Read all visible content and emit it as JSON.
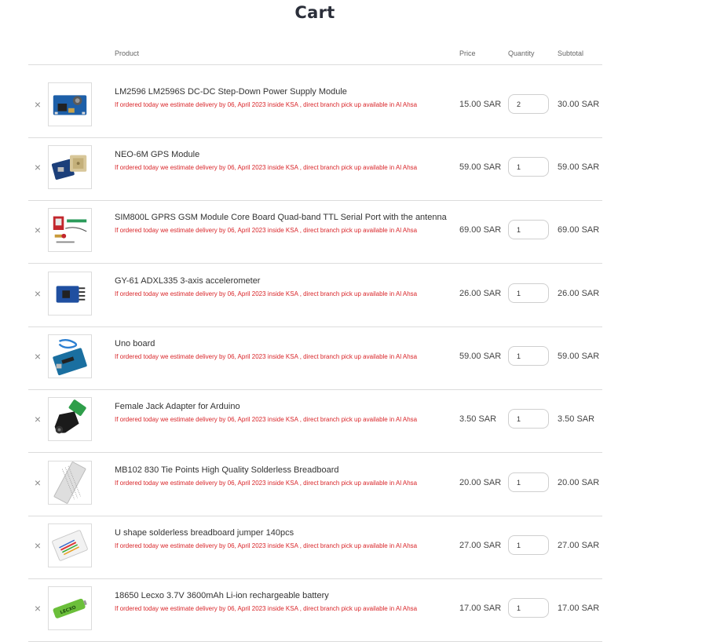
{
  "page": {
    "title": "Cart"
  },
  "table": {
    "headers": {
      "product": "Product",
      "price": "Price",
      "quantity": "Quantity",
      "subtotal": "Subtotal"
    }
  },
  "cart": {
    "remove_symbol": "×",
    "delivery_note": "If ordered today we estimate delivery by 06, April 2023 inside KSA , direct branch pick up available in Al Ahsa",
    "items": [
      {
        "name": "LM2596 LM2596S DC-DC Step-Down Power Supply Module",
        "price": "15.00 SAR",
        "quantity": "2",
        "subtotal": "30.00 SAR",
        "image": "blue-power-module"
      },
      {
        "name": "NEO-6M GPS Module",
        "price": "59.00 SAR",
        "quantity": "1",
        "subtotal": "59.00 SAR",
        "image": "gps-module"
      },
      {
        "name": "SIM800L GPRS GSM Module Core Board Quad-band TTL Serial Port with the antenna",
        "price": "69.00 SAR",
        "quantity": "1",
        "subtotal": "69.00 SAR",
        "image": "gsm-module"
      },
      {
        "name": "GY-61 ADXL335 3-axis accelerometer",
        "price": "26.00 SAR",
        "quantity": "1",
        "subtotal": "26.00 SAR",
        "image": "accelerometer-board"
      },
      {
        "name": "Uno board",
        "price": "59.00 SAR",
        "quantity": "1",
        "subtotal": "59.00 SAR",
        "image": "arduino-uno"
      },
      {
        "name": "Female Jack Adapter for Arduino",
        "price": "3.50 SAR",
        "quantity": "1",
        "subtotal": "3.50 SAR",
        "image": "dc-jack-adapter"
      },
      {
        "name": "MB102 830 Tie Points High Quality Solderless Breadboard",
        "price": "20.00 SAR",
        "quantity": "1",
        "subtotal": "20.00 SAR",
        "image": "breadboard"
      },
      {
        "name": "U shape solderless breadboard jumper 140pcs",
        "price": "27.00 SAR",
        "quantity": "1",
        "subtotal": "27.00 SAR",
        "image": "jumper-kit"
      },
      {
        "name": "18650 Lecxo 3.7V 3600mAh Li-ion rechargeable battery",
        "price": "17.00 SAR",
        "quantity": "1",
        "subtotal": "17.00 SAR",
        "image": "li-ion-battery",
        "image_label": "LECXO"
      }
    ]
  }
}
